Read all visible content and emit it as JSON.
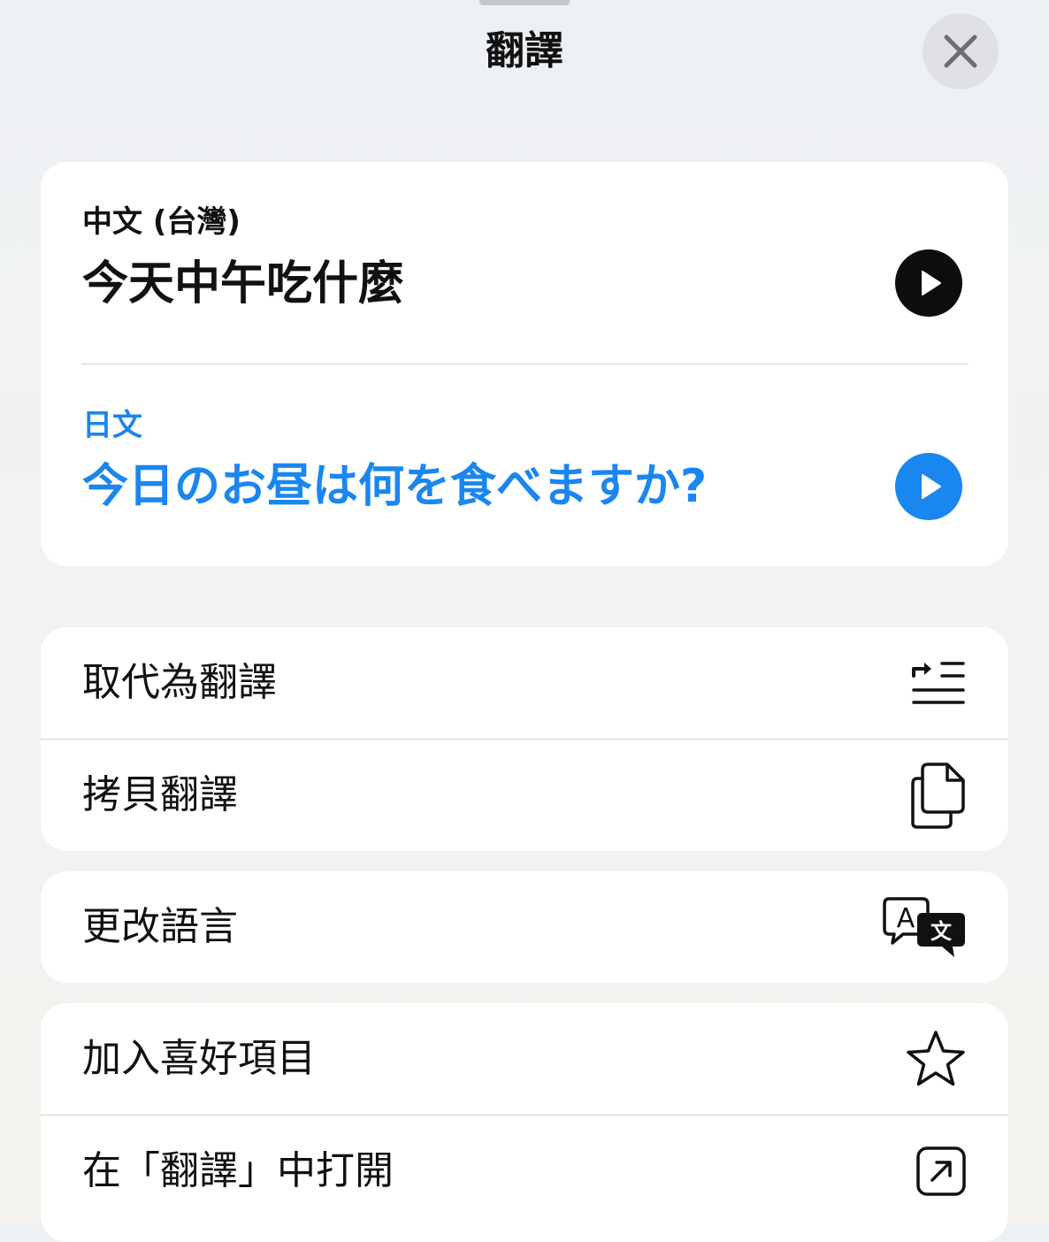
{
  "sheet": {
    "title": "翻譯",
    "close_icon": "close-icon"
  },
  "translation": {
    "source": {
      "language": "中文 (台灣)",
      "text": "今天中午吃什麼",
      "play_icon": "play-icon"
    },
    "target": {
      "language": "日文",
      "text": "今日のお昼は何を食べますか?",
      "play_icon": "play-icon"
    },
    "accent_color": "#1a86f0"
  },
  "actions": [
    {
      "label": "取代為翻譯",
      "icon": "replace-text-icon"
    },
    {
      "label": "拷貝翻譯",
      "icon": "copy-icon"
    },
    {
      "label": "更改語言",
      "icon": "translate-bubbles-icon"
    },
    {
      "label": "加入喜好項目",
      "icon": "star-icon"
    },
    {
      "label": "在「翻譯」中打開",
      "icon": "open-in-app-icon"
    }
  ]
}
